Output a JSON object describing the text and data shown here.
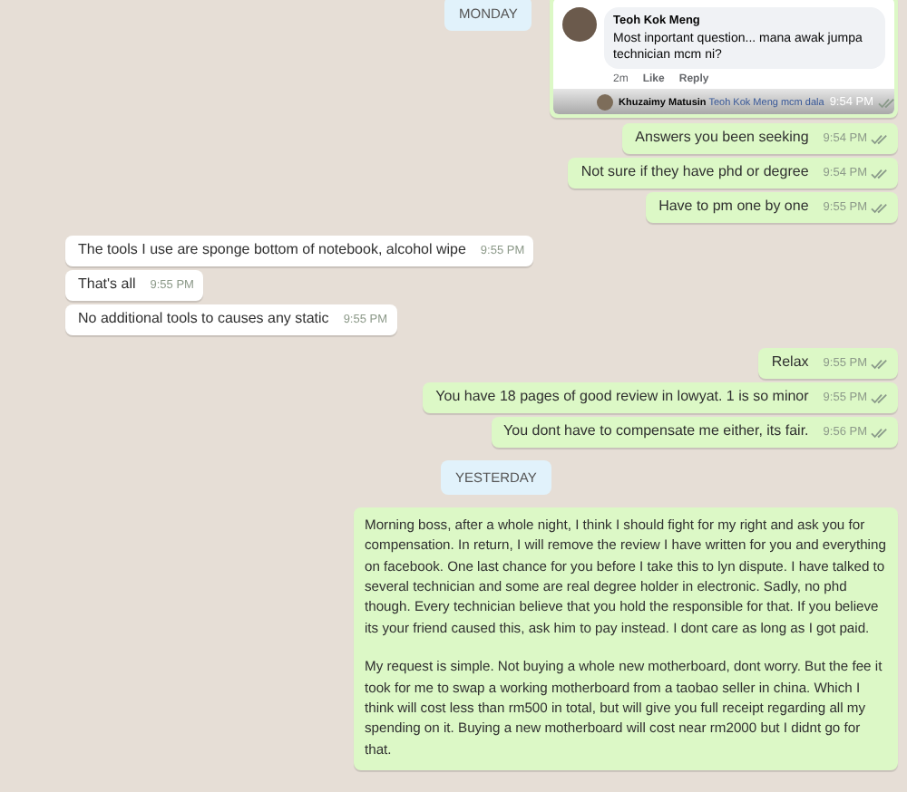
{
  "items": [
    {
      "kind": "date",
      "label": "MONDAY"
    },
    {
      "kind": "image",
      "outgoing": true,
      "time": "9:54 PM",
      "comment": {
        "author": "Teoh Kok Meng",
        "text": "Most inportant question... mana awak jumpa technician mcm ni?",
        "age": "2m",
        "actions": [
          "Like",
          "Reply"
        ]
      },
      "reply": {
        "author": "Khuzaimy Matusin",
        "text": "Teoh Kok Meng mcm dala"
      }
    },
    {
      "kind": "text",
      "outgoing": true,
      "text": "Answers you been seeking",
      "time": "9:54 PM"
    },
    {
      "kind": "text",
      "outgoing": true,
      "text": "Not sure if they have phd or degree",
      "time": "9:54 PM"
    },
    {
      "kind": "text",
      "outgoing": true,
      "text": "Have to pm one by one",
      "time": "9:55 PM"
    },
    {
      "kind": "text",
      "outgoing": false,
      "text": "The tools I use are sponge bottom of notebook, alcohol wipe",
      "time": "9:55 PM"
    },
    {
      "kind": "text",
      "outgoing": false,
      "text": "That's all",
      "time": "9:55 PM"
    },
    {
      "kind": "text",
      "outgoing": false,
      "text": "No additional tools to causes any static",
      "time": "9:55 PM"
    },
    {
      "kind": "text",
      "outgoing": true,
      "text": "Relax",
      "time": "9:55 PM"
    },
    {
      "kind": "text",
      "outgoing": true,
      "text": "You have 18 pages of good review in lowyat. 1 is so minor",
      "time": "9:55 PM"
    },
    {
      "kind": "text",
      "outgoing": true,
      "text": "You dont have to compensate me either, its fair.",
      "time": "9:56 PM"
    },
    {
      "kind": "date",
      "label": "YESTERDAY"
    },
    {
      "kind": "long",
      "outgoing": true,
      "paragraphs": [
        "Morning boss, after a whole night, I think I should fight for my right and ask you for compensation. In return, I will remove the review I have written for you and everything on facebook. One last chance for you before I take this to lyn dispute. I have talked to several technician and some are real degree holder in electronic. Sadly, no phd though. Every technician believe that you hold the responsible for that. If you believe its your friend caused this, ask him to pay instead. I dont care as long as I got paid.",
        "My request is simple. Not buying a whole new motherboard, dont worry. But the fee it took for me to swap a working motherboard from a taobao seller in china. Which I think will cost less than rm500 in total, but will give you full receipt regarding all my spending on it. Buying a new motherboard will cost near rm2000 but I didnt go for that."
      ]
    }
  ]
}
